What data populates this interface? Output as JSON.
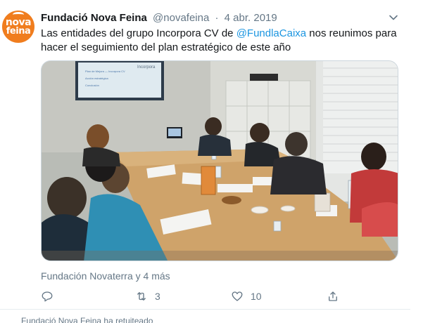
{
  "tweet": {
    "author": {
      "name": "Fundació Nova Feina",
      "handle": "@novafeina",
      "avatar_text_line1": "nova",
      "avatar_text_line2": "feina",
      "avatar_color": "#f07d1e"
    },
    "separator": "·",
    "date": "4 abr. 2019",
    "text_before": "Las entidades del grupo Incorpora CV de ",
    "mention": "@FundlaCaixa",
    "text_after": " nos reunimos para hacer el seguimiento del plan estratégico de este año",
    "liked_by": "Fundación Novaterra y 4 más",
    "actions": {
      "reply_count": "",
      "retweet_count": "3",
      "like_count": "10"
    },
    "media": {
      "slide_title": "Incorpora",
      "slide_bullets": [
        "Plan de Mejora — Incorpora CV",
        "Acción estratégica",
        "Conclusión"
      ]
    }
  },
  "next_tweet_preview": "Fundació Nova Feina ha retuiteado",
  "colors": {
    "link": "#1b95e0",
    "secondary_text": "#657786",
    "border": "#e6ecf0"
  }
}
